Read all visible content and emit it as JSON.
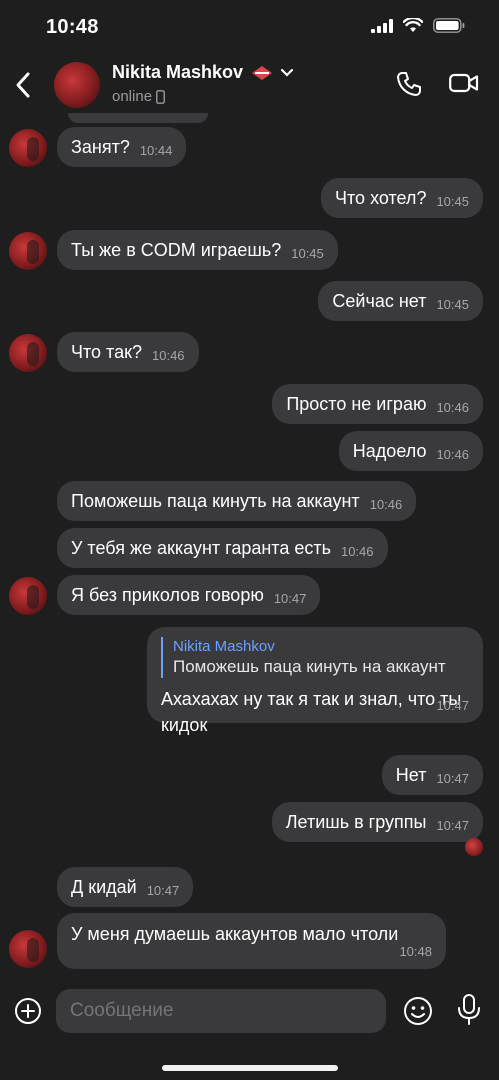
{
  "status_bar": {
    "time": "10:48"
  },
  "header": {
    "contact_name": "Nikita Mashkov",
    "contact_status": "online"
  },
  "messages": [
    {
      "text": "Занят?",
      "time": "10:44"
    },
    {
      "text": "Что хотел?",
      "time": "10:45"
    },
    {
      "text": "Ты же в CODM играешь?",
      "time": "10:45"
    },
    {
      "text": "Сейчас нет",
      "time": "10:45"
    },
    {
      "text": "Что так?",
      "time": "10:46"
    },
    {
      "text": "Просто не играю",
      "time": "10:46"
    },
    {
      "text": "Надоело",
      "time": "10:46"
    },
    {
      "text": "Поможешь паца кинуть на аккаунт",
      "time": "10:46"
    },
    {
      "text": "У тебя же аккаунт гаранта есть",
      "time": "10:46"
    },
    {
      "text": "Я без приколов говорю",
      "time": "10:47"
    },
    {
      "quote_name": "Nikita Mashkov",
      "quote_text": "Поможешь паца кинуть на аккаунт",
      "text": "Ахахахах ну так я так и знал, что ты кидок",
      "time": "10:47"
    },
    {
      "text": "Нет",
      "time": "10:47"
    },
    {
      "text": "Летишь в группы",
      "time": "10:47"
    },
    {
      "text": "Д кидай",
      "time": "10:47"
    },
    {
      "text": "У меня думаешь аккаунтов мало чтоли",
      "time": "10:48"
    }
  ],
  "composer": {
    "placeholder": "Сообщение"
  },
  "colors": {
    "background": "#1e1e1f",
    "bubble": "#3a3a3c",
    "quote_accent": "#6aa2ff",
    "brand_red": "#c9383a"
  }
}
